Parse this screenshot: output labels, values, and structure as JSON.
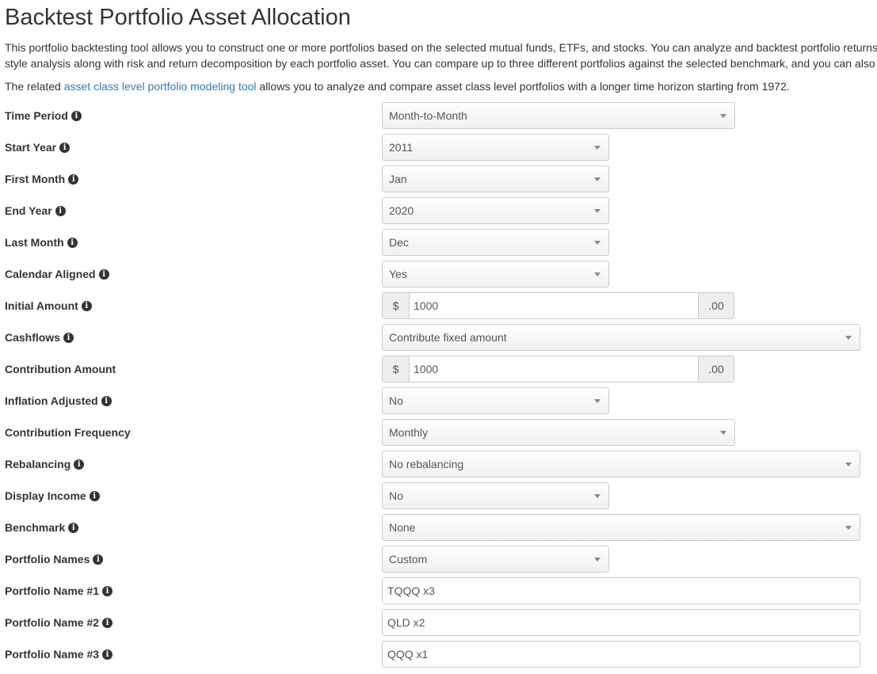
{
  "page": {
    "title": "Backtest Portfolio Asset Allocation",
    "intro_line1": "This portfolio backtesting tool allows you to construct one or more portfolios based on the selected mutual funds, ETFs, and stocks. You can analyze and backtest portfolio returns",
    "intro_line2": "style analysis along with risk and return decomposition by each portfolio asset. You can compare up to three different portfolios against the selected benchmark, and you can also",
    "related_prefix": "The related ",
    "related_link": "asset class level portfolio modeling tool",
    "related_suffix": " allows you to analyze and compare asset class level portfolios with a longer time horizon starting from 1972."
  },
  "form": {
    "time_period": {
      "label": "Time Period",
      "value": "Month-to-Month"
    },
    "start_year": {
      "label": "Start Year",
      "value": "2011"
    },
    "first_month": {
      "label": "First Month",
      "value": "Jan"
    },
    "end_year": {
      "label": "End Year",
      "value": "2020"
    },
    "last_month": {
      "label": "Last Month",
      "value": "Dec"
    },
    "calendar_aligned": {
      "label": "Calendar Aligned",
      "value": "Yes"
    },
    "initial_amount": {
      "label": "Initial Amount",
      "prefix": "$",
      "value": "1000",
      "suffix": ".00"
    },
    "cashflows": {
      "label": "Cashflows",
      "value": "Contribute fixed amount"
    },
    "contribution_amount": {
      "label": "Contribution Amount",
      "prefix": "$",
      "value": "1000",
      "suffix": ".00"
    },
    "inflation_adjusted": {
      "label": "Inflation Adjusted",
      "value": "No"
    },
    "contribution_frequency": {
      "label": "Contribution Frequency",
      "value": "Monthly"
    },
    "rebalancing": {
      "label": "Rebalancing",
      "value": "No rebalancing"
    },
    "display_income": {
      "label": "Display Income",
      "value": "No"
    },
    "benchmark": {
      "label": "Benchmark",
      "value": "None"
    },
    "portfolio_names": {
      "label": "Portfolio Names",
      "value": "Custom"
    },
    "portfolio_name_1": {
      "label": "Portfolio Name #1",
      "value": "TQQQ x3"
    },
    "portfolio_name_2": {
      "label": "Portfolio Name #2",
      "value": "QLD x2"
    },
    "portfolio_name_3": {
      "label": "Portfolio Name #3",
      "value": "QQQ x1"
    }
  },
  "icons": {
    "info": "info-circle-icon",
    "dropdown": "chevron-down-icon"
  },
  "colors": {
    "link": "#337ab7",
    "text": "#333333",
    "addon_bg": "#eeeeee",
    "border": "#cccccc"
  }
}
